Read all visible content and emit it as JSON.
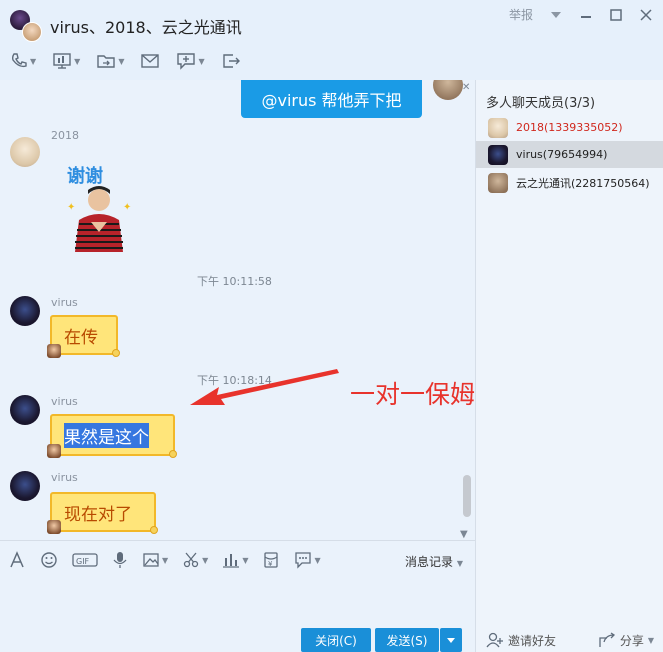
{
  "window": {
    "title": "virus、2018、云之光通讯",
    "report_label": "举报",
    "controls": [
      "dropdown-icon",
      "minimize-icon",
      "maximize-icon",
      "close-icon"
    ]
  },
  "toolbar": {
    "items": [
      "phone-icon",
      "screen-share-icon",
      "folder-icon",
      "mail-icon",
      "add-app-icon",
      "exit-icon"
    ]
  },
  "chat": {
    "mention_bubble": "@virus 帮他弄下把",
    "messages": [
      {
        "sender": "2018",
        "type": "sticker",
        "sticker_text": "谢谢"
      },
      {
        "time": "下午 10:11:58"
      },
      {
        "sender": "virus",
        "text": "在传"
      },
      {
        "time": "下午 10:18:14"
      },
      {
        "sender": "virus",
        "text": "果然是这个"
      },
      {
        "sender": "virus",
        "text": "现在对了"
      }
    ],
    "annotation": "一对一保姆式指导服务"
  },
  "sidebar": {
    "title": "多人聊天成员(3/3)",
    "members": [
      {
        "name": "2018(1339335052)",
        "color": "#d0281e",
        "selected": false
      },
      {
        "name": "virus(79654994)",
        "color": "#222222",
        "selected": true
      },
      {
        "name": "云之光通讯(2281750564)",
        "color": "#222222",
        "selected": false
      }
    ],
    "invite_label": "邀请好友",
    "share_label": "分享"
  },
  "input": {
    "history_label": "消息记录",
    "close_button": "关闭(C)",
    "send_button": "发送(S)"
  },
  "colors": {
    "accent_blue": "#1a9be6",
    "bubble_yellow": "#ffe57a",
    "bubble_border": "#f2b829",
    "annotation_red": "#e8332c"
  }
}
